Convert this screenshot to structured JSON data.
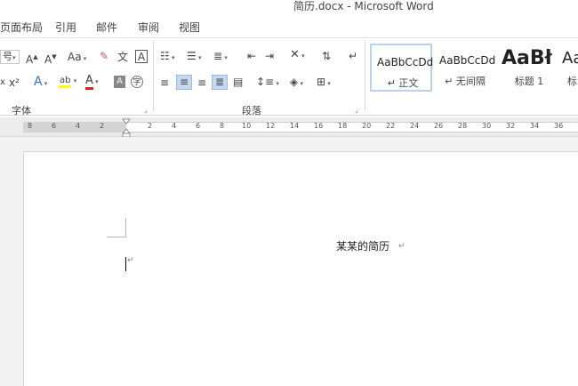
{
  "window": {
    "title": "简历.docx - Microsoft Word"
  },
  "tabs": [
    {
      "label": "页面布局"
    },
    {
      "label": "引用"
    },
    {
      "label": "邮件"
    },
    {
      "label": "审阅"
    },
    {
      "label": "视图"
    }
  ],
  "font_group": {
    "label": "字体",
    "font_size_partial": "号",
    "grow_label": "A",
    "shrink_label": "A",
    "case_label": "Aa",
    "phonetic_label": "文",
    "border_char_label": "A",
    "superscript_label": "x²",
    "subscript_partial": "x",
    "effects_label": "A",
    "highlight_label": "ab",
    "font_color_label": "A",
    "shading_label": "A",
    "enclose_label": "字"
  },
  "paragraph_group": {
    "label": "段落"
  },
  "styles": [
    {
      "preview": "AaBbCcDd",
      "name": "↵ 正文"
    },
    {
      "preview": "AaBbCcDd",
      "name": "↵ 无间隔"
    },
    {
      "preview": "AaBł",
      "name": "标题 1"
    },
    {
      "preview": "Aa",
      "name": "标"
    }
  ],
  "ruler": {
    "left_ticks": [
      "8",
      "6",
      "4",
      "2"
    ],
    "right_ticks": [
      "2",
      "4",
      "6",
      "8",
      "10",
      "12",
      "14",
      "16",
      "18",
      "20",
      "22",
      "24",
      "26",
      "28",
      "30",
      "32",
      "34",
      "36"
    ]
  },
  "document": {
    "text": "某某的简历",
    "paragraph_mark": "↵"
  },
  "colors": {
    "accent": "#2b579a",
    "font_color": "#e02020",
    "highlight": "#ffff00"
  }
}
